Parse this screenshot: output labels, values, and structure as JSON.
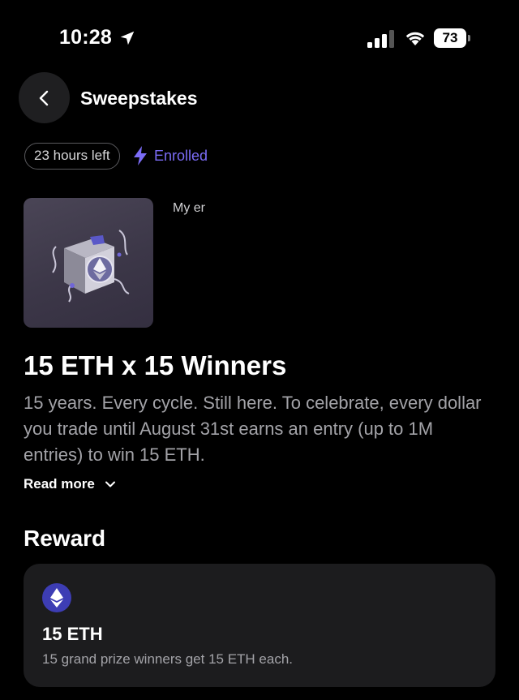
{
  "status_bar": {
    "time": "10:28",
    "battery": "73"
  },
  "header": {
    "title": "Sweepstakes"
  },
  "badges": {
    "time_left": "23 hours left",
    "enrolled": "Enrolled"
  },
  "entries": {
    "label": "My er"
  },
  "promo": {
    "headline": "15 ETH x 15 Winners",
    "description": "15 years. Every cycle. Still here. To celebrate, every dollar you trade until August 31st earns an entry (up to 1M entries) to win 15 ETH.",
    "read_more": "Read more"
  },
  "reward": {
    "section_title": "Reward",
    "amount": "15 ETH",
    "description": "15 grand prize winners get 15 ETH each."
  },
  "icons": {
    "back": "chevron-left-icon",
    "enrolled": "lightning-bolt-icon",
    "read_more": "chevron-down-icon",
    "reward": "ethereum-icon"
  },
  "colors": {
    "background": "#000000",
    "accent": "#7b6cf6",
    "card": "#1c1c1e",
    "eth_coin": "#3d3db4"
  }
}
